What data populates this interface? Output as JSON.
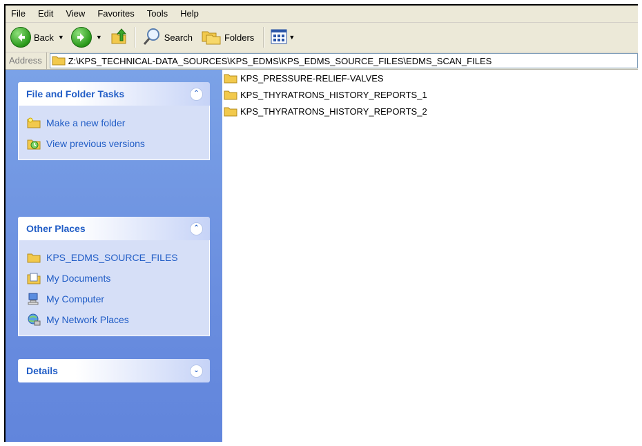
{
  "menu": [
    "File",
    "Edit",
    "View",
    "Favorites",
    "Tools",
    "Help"
  ],
  "toolbar": {
    "back_label": "Back",
    "search_label": "Search",
    "folders_label": "Folders"
  },
  "address": {
    "label": "Address",
    "path": "Z:\\KPS_TECHNICAL-DATA_SOURCES\\KPS_EDMS\\KPS_EDMS_SOURCE_FILES\\EDMS_SCAN_FILES"
  },
  "panels": {
    "file_tasks": {
      "title": "File and Folder Tasks",
      "items": [
        "Make a new folder",
        "View previous versions"
      ]
    },
    "other_places": {
      "title": "Other Places",
      "items": [
        "KPS_EDMS_SOURCE_FILES",
        "My Documents",
        "My Computer",
        "My Network Places"
      ]
    },
    "details": {
      "title": "Details"
    }
  },
  "files": [
    "KPS_PRESSURE-RELIEF-VALVES",
    "KPS_THYRATRONS_HISTORY_REPORTS_1",
    "KPS_THYRATRONS_HISTORY_REPORTS_2"
  ],
  "colors": {
    "task_link": "#215dc6",
    "pane_bg": "#6f93e0",
    "folder": "#f2c94c"
  }
}
